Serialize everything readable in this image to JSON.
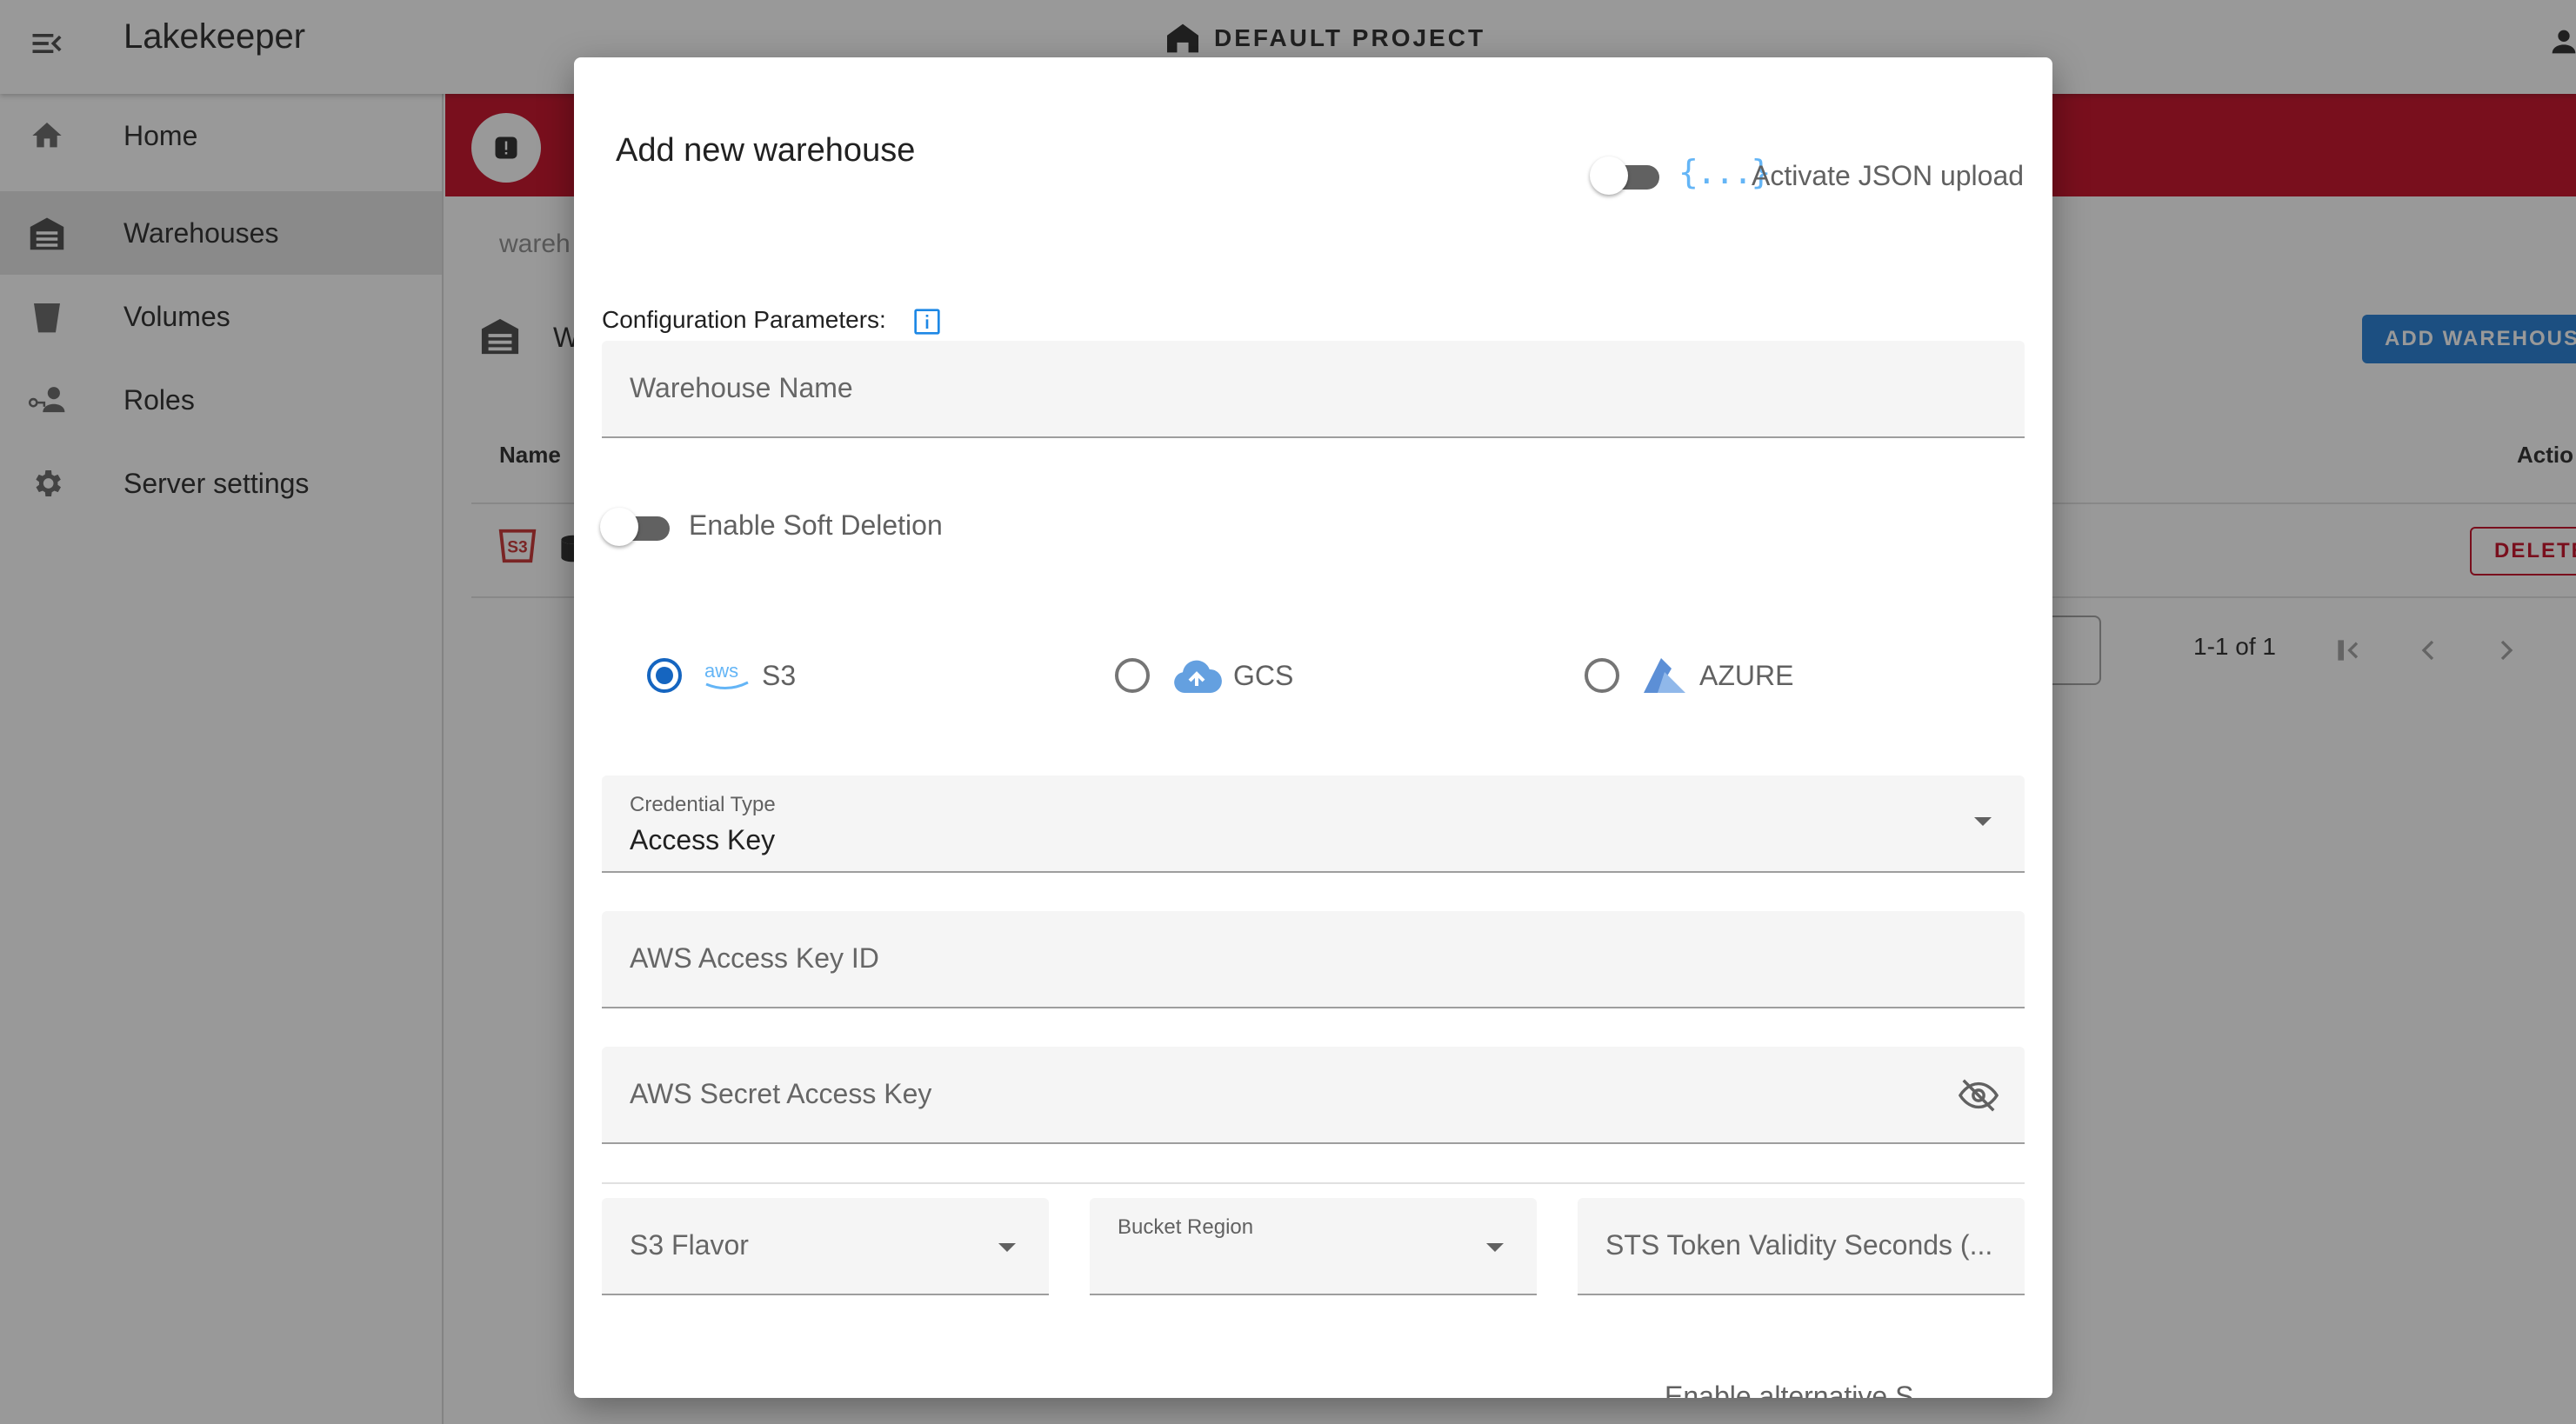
{
  "app": {
    "title": "Lakekeeper",
    "project": "DEFAULT PROJECT"
  },
  "sidebar": {
    "items": [
      {
        "label": "Home",
        "icon": "home-icon"
      },
      {
        "label": "Warehouses",
        "icon": "warehouse-icon",
        "active": true
      },
      {
        "label": "Volumes",
        "icon": "bucket-icon"
      },
      {
        "label": "Roles",
        "icon": "roles-icon"
      },
      {
        "label": "Server settings",
        "icon": "gear-icon"
      }
    ]
  },
  "main": {
    "breadcrumb": "wareh",
    "title": "W",
    "add_button": "ADD WAREHOUSE",
    "table": {
      "col_name": "Name",
      "col_actions": "Actio"
    },
    "row": {
      "delete_label": "DELETE"
    },
    "pagination": "1-1 of 1"
  },
  "dialog": {
    "title": "Add new warehouse",
    "json_toggle": {
      "icon_text": "{...}",
      "label": "Activate JSON upload",
      "on": false
    },
    "config_label": "Configuration Parameters:",
    "warehouse_name": {
      "placeholder": "Warehouse Name",
      "value": ""
    },
    "soft_deletion": {
      "label": "Enable Soft Deletion",
      "on": false
    },
    "storage": {
      "options": [
        {
          "label": "S3",
          "logo": "aws-logo",
          "checked": true
        },
        {
          "label": "GCS",
          "logo": "gcs-cloud-icon",
          "checked": false
        },
        {
          "label": "AZURE",
          "logo": "azure-logo",
          "checked": false
        }
      ]
    },
    "credential_type": {
      "label": "Credential Type",
      "value": "Access Key"
    },
    "access_key_id": {
      "placeholder": "AWS Access Key ID"
    },
    "secret_access_key": {
      "placeholder": "AWS Secret Access Key"
    },
    "s3_flavor": {
      "placeholder": "S3 Flavor"
    },
    "bucket_region": {
      "label": "Bucket Region",
      "value": ""
    },
    "sts_validity": {
      "placeholder": "STS Token Validity Seconds (..."
    },
    "cut_off_text": "Enable alternative S"
  },
  "colors": {
    "accent": "#1976d2",
    "banner": "#c4001b",
    "radio_checked": "#1565c0",
    "json_icon": "#64b5f6"
  }
}
